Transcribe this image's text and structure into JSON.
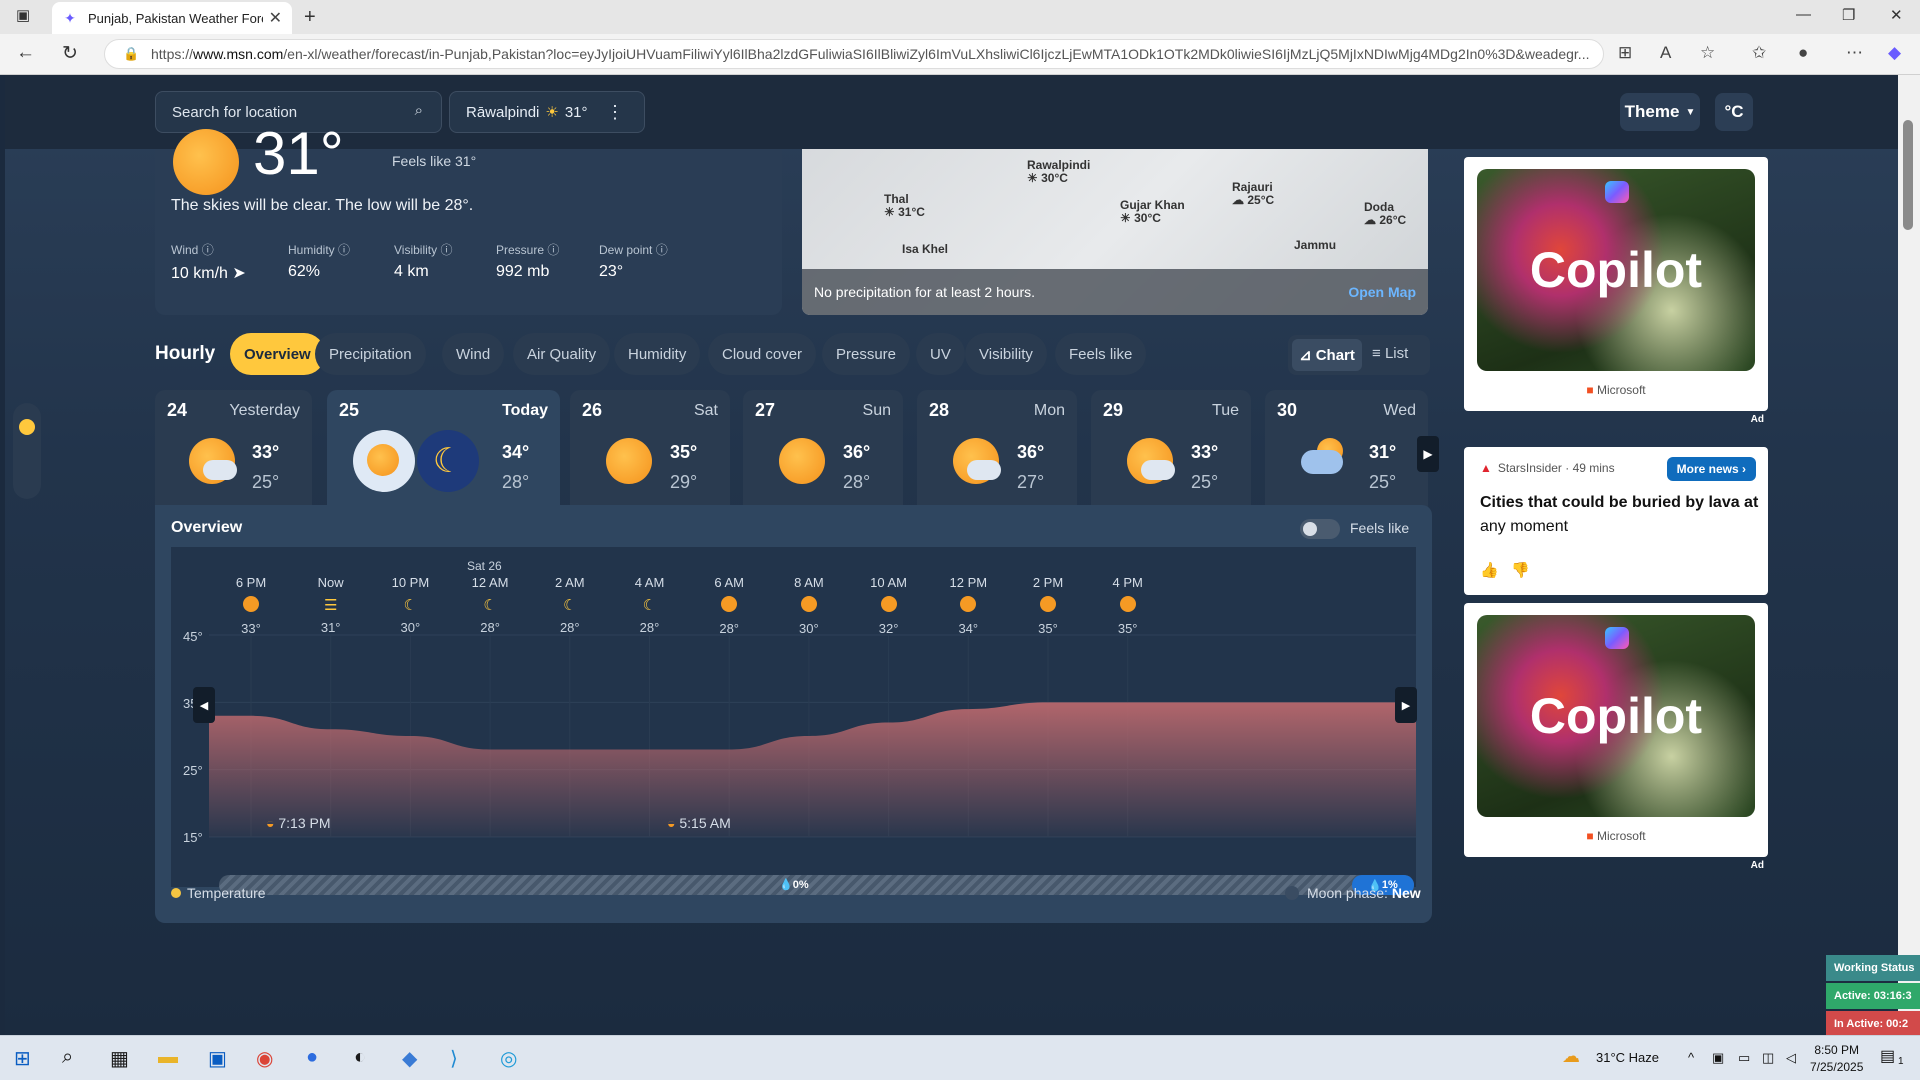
{
  "browser": {
    "tab_title": "Punjab, Pakistan Weather Forecas",
    "url_prefix": "https://",
    "url_domain": "www.msn.com",
    "url_rest": "/en-xl/weather/forecast/in-Punjab,Pakistan?loc=eyJyIjoiUHVuamFiliwiYyl6IlBha2lzdGFuliwiaSI6IlBliwiZyl6ImVuLXhsliwiCl6IjczLjEwMTA1ODk1OTk2MDk0liwieSI6IjMzLjQ5MjIxNDIwMjg4MDg2In0%3D&weadegr..."
  },
  "header": {
    "search_placeholder": "Search for location",
    "location_name": "Rāwalpindi",
    "location_temp": "31°",
    "theme_label": "Theme",
    "unit_label": "°C"
  },
  "current": {
    "big_temp": "31°",
    "feels_like": "Feels like 31°",
    "description": "The skies will be clear. The low will be 28°.",
    "stats": [
      {
        "label": "Wind",
        "value": "10 km/h"
      },
      {
        "label": "Humidity",
        "value": "62%"
      },
      {
        "label": "Visibility",
        "value": "4 km"
      },
      {
        "label": "Pressure",
        "value": "992 mb"
      },
      {
        "label": "Dew point",
        "value": "23°"
      }
    ]
  },
  "map": {
    "cities": [
      {
        "name": "Rawalpindi",
        "temp": "30°C"
      },
      {
        "name": "Thal",
        "temp": "31°C"
      },
      {
        "name": "Gujar Khan",
        "temp": "30°C"
      },
      {
        "name": "Rajauri",
        "temp": "25°C"
      },
      {
        "name": "Doda",
        "temp": "26°C"
      },
      {
        "name": "Isa Khel",
        "temp": ""
      },
      {
        "name": "Jammu",
        "temp": ""
      }
    ],
    "precip_note": "No precipitation for at least 2 hours.",
    "open_map": "Open Map"
  },
  "hourly": {
    "title": "Hourly",
    "tabs": [
      "Overview",
      "Precipitation",
      "Wind",
      "Air Quality",
      "Humidity",
      "Cloud cover",
      "Pressure",
      "UV",
      "Visibility",
      "Feels like"
    ],
    "active_tab": "Overview",
    "view_chart": "Chart",
    "view_list": "List"
  },
  "days": [
    {
      "num": "24",
      "label": "Yesterday",
      "hi": "33°",
      "lo": "25°",
      "icon": "sun-cloud-icon"
    },
    {
      "num": "25",
      "label": "Today",
      "hi": "34°",
      "lo": "28°",
      "icon": "sun-cloud-moon-icon"
    },
    {
      "num": "26",
      "label": "Sat",
      "hi": "35°",
      "lo": "29°",
      "icon": "sun-icon"
    },
    {
      "num": "27",
      "label": "Sun",
      "hi": "36°",
      "lo": "28°",
      "icon": "sun-icon"
    },
    {
      "num": "28",
      "label": "Mon",
      "hi": "36°",
      "lo": "27°",
      "icon": "sun-cloud-icon"
    },
    {
      "num": "29",
      "label": "Tue",
      "hi": "33°",
      "lo": "25°",
      "icon": "sun-cloud-icon"
    },
    {
      "num": "30",
      "label": "Wed",
      "hi": "31°",
      "lo": "25°",
      "icon": "rain-cloud-icon"
    }
  ],
  "overview": {
    "title": "Overview",
    "feels_toggle_label": "Feels like",
    "date_marker": "Sat 26",
    "sunset": "7:13 PM",
    "sunrise": "5:15 AM",
    "precip_mid": "0%",
    "precip_end": "1%",
    "legend_temp": "Temperature",
    "moon_phase_label": "Moon phase:",
    "moon_phase_value": "New",
    "hours": [
      {
        "time": "6 PM",
        "temp": "33°",
        "icon": "sun"
      },
      {
        "time": "Now",
        "temp": "31°",
        "icon": "haze"
      },
      {
        "time": "10 PM",
        "temp": "30°",
        "icon": "moon"
      },
      {
        "time": "12 AM",
        "temp": "28°",
        "icon": "moon"
      },
      {
        "time": "2 AM",
        "temp": "28°",
        "icon": "moon"
      },
      {
        "time": "4 AM",
        "temp": "28°",
        "icon": "moon"
      },
      {
        "time": "6 AM",
        "temp": "28°",
        "icon": "sun"
      },
      {
        "time": "8 AM",
        "temp": "30°",
        "icon": "sun"
      },
      {
        "time": "10 AM",
        "temp": "32°",
        "icon": "sun"
      },
      {
        "time": "12 PM",
        "temp": "34°",
        "icon": "sun"
      },
      {
        "time": "2 PM",
        "temp": "35°",
        "icon": "sun"
      },
      {
        "time": "4 PM",
        "temp": "35°",
        "icon": "sun"
      }
    ]
  },
  "chart_data": {
    "type": "area",
    "title": "Overview",
    "series": [
      {
        "name": "Temperature",
        "values": [
          33,
          31,
          30,
          28,
          28,
          28,
          28,
          30,
          32,
          34,
          35,
          35
        ]
      }
    ],
    "categories": [
      "6 PM",
      "Now",
      "10 PM",
      "12 AM",
      "2 AM",
      "4 AM",
      "6 AM",
      "8 AM",
      "10 AM",
      "12 PM",
      "2 PM",
      "4 PM"
    ],
    "ylim": [
      15,
      45
    ],
    "yticks": [
      "45°",
      "35°",
      "25°",
      "15°"
    ],
    "color": "#b9686d"
  },
  "ads": {
    "ad1_brand": "Copilot",
    "ad1_sponsor": "Microsoft",
    "ad_tag": "Ad",
    "news_source": "StarsInsider · 49 mins",
    "news_button": "More news",
    "news_headline_bold": "Cities that could be buried by lava at",
    "news_headline_rest": "any moment",
    "ad2_brand": "Copilot",
    "ad2_sponsor": "Microsoft"
  },
  "work_status": {
    "title": "Working Status",
    "active": "Active: 03:16:3",
    "inactive": "In Active: 00:2"
  },
  "taskbar": {
    "weather": "31°C Haze",
    "time": "8:50 PM",
    "date": "7/25/2025",
    "notifications": "1"
  }
}
